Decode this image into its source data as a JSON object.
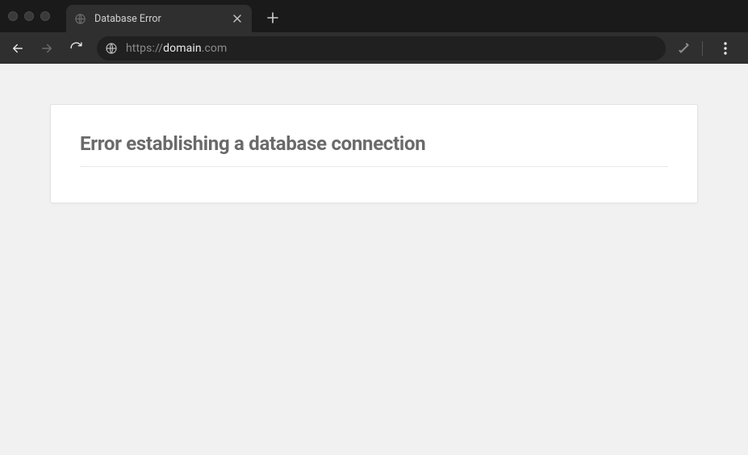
{
  "tab": {
    "title": "Database Error"
  },
  "url": {
    "protocol": "https://",
    "host": "domain",
    "rest": ".com"
  },
  "page": {
    "heading": "Error establishing a database connection"
  }
}
